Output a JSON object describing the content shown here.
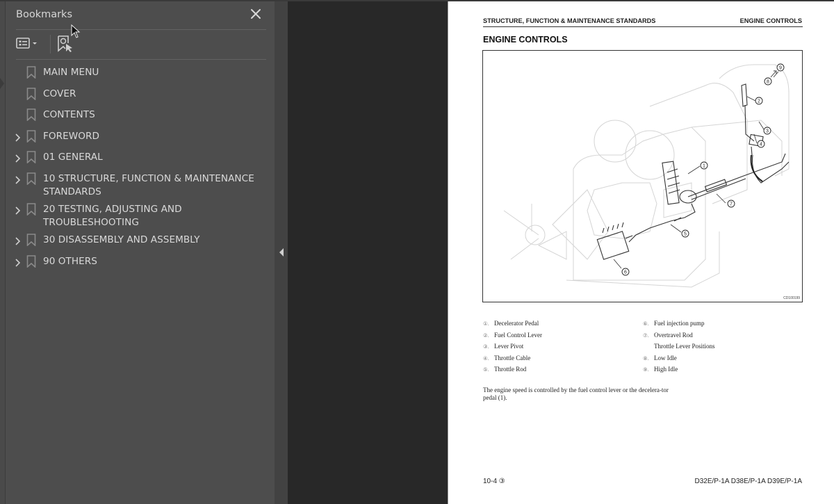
{
  "bookmarks_panel": {
    "title": "Bookmarks",
    "close_icon": "close-icon",
    "options_icon": "list-options-icon",
    "find_icon": "find-current-bookmark-icon",
    "items": [
      {
        "label": "MAIN MENU",
        "expandable": false
      },
      {
        "label": "COVER",
        "expandable": false
      },
      {
        "label": "CONTENTS",
        "expandable": false
      },
      {
        "label": "FOREWORD",
        "expandable": true
      },
      {
        "label": "01 GENERAL",
        "expandable": true
      },
      {
        "label": "10 STRUCTURE, FUNCTION & MAINTENANCE STANDARDS",
        "expandable": true
      },
      {
        "label": "20 TESTING, ADJUSTING AND TROUBLESHOOTING",
        "expandable": true
      },
      {
        "label": "30 DISASSEMBLY AND ASSEMBLY",
        "expandable": true
      },
      {
        "label": "90 OTHERS",
        "expandable": true
      }
    ]
  },
  "splitter": {
    "collapse_icon": "collapse-left-arrow-icon"
  },
  "page": {
    "header_left": "STRUCTURE, FUNCTION & MAINTENANCE STANDARDS",
    "header_right": "ENGINE CONTROLS",
    "title": "ENGINE CONTROLS",
    "figure": {
      "code": "CD100199",
      "callouts": [
        "1",
        "2",
        "3",
        "4",
        "5",
        "6",
        "7",
        "8",
        "9"
      ]
    },
    "legend_left": [
      {
        "num": "①.",
        "text": "Decelerator Pedal"
      },
      {
        "num": "②.",
        "text": "Fuel Control Lever"
      },
      {
        "num": "③.",
        "text": "Lever Pivot"
      },
      {
        "num": "④.",
        "text": "Throttle Cable"
      },
      {
        "num": "⑤.",
        "text": "Throttle Rod"
      }
    ],
    "legend_right": [
      {
        "num": "⑥.",
        "text": "Fuel injection pump"
      },
      {
        "num": "⑦.",
        "text": "Overtravel Rod"
      },
      {
        "num": "",
        "text": "Throttle Lever Positions"
      },
      {
        "num": "⑧.",
        "text": "Low Idle"
      },
      {
        "num": "⑨.",
        "text": "High Idle"
      }
    ],
    "body_text": "The engine speed is controlled by the fuel control lever or the decelera-tor pedal (1).",
    "footer_left": "10-4 ③",
    "footer_right": "D32E/P-1A D38E/P-1A D39E/P-1A"
  }
}
